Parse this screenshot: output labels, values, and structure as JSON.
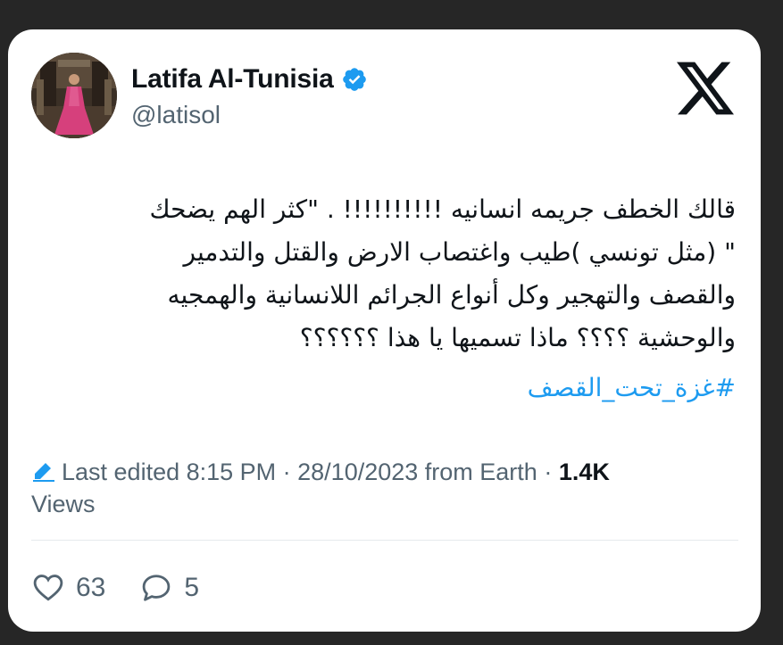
{
  "author": {
    "display_name": "Latifa Al-Tunisia",
    "handle": "@latisol",
    "verified": true,
    "avatar": "avatar-photo"
  },
  "brand": {
    "logo": "x-logo-icon"
  },
  "tweet": {
    "lines": [
      "قالك الخطف جريمه انسانيه !!!!!!!!!! . \"كثر الهم يضحك",
      "\" (مثل تونسي )طيب واغتصاب الارض والقتل والتدمير",
      "والقصف والتهجير وكل أنواع الجرائم اللانسانية والهمجيه",
      "والوحشية ؟؟؟؟ ماذا تسميها يا هذا ؟؟؟؟؟؟"
    ],
    "hashtag": "#غزة_تحت_القصف"
  },
  "meta": {
    "edited_label": "Last edited 8:15 PM · 28/10/2023  from Earth · ",
    "views_count": "1.4K",
    "views_label": "Views"
  },
  "actions": {
    "likes": "63",
    "replies": "5"
  },
  "colors": {
    "accent": "#1d9bf0",
    "text": "#0f1419",
    "muted": "#536471",
    "background": "#262626",
    "card": "#ffffff"
  }
}
